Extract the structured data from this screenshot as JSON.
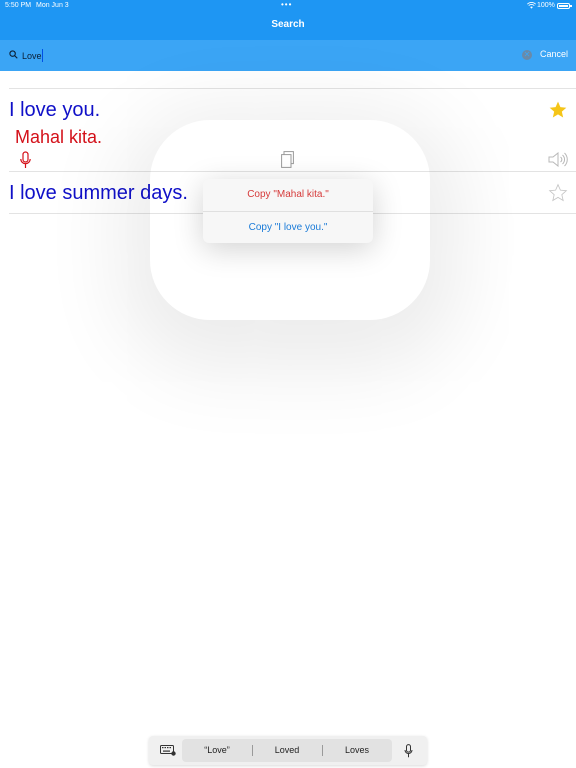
{
  "status_bar": {
    "time": "5:50 PM",
    "date": "Mon Jun 3",
    "battery": "100%"
  },
  "nav": {
    "title": "Search"
  },
  "search": {
    "value": "Love",
    "cancel_label": "Cancel"
  },
  "results": [
    {
      "english": "I love you.",
      "translation": "Mahal kita.",
      "favorite": true
    },
    {
      "english": "I love summer days.",
      "favorite": false
    }
  ],
  "copy_menu": {
    "items": [
      "Copy \"Mahal kita.\"",
      "Copy \"I love you.\""
    ]
  },
  "keyboard_suggestions": [
    "“Love”",
    "Loved",
    "Loves"
  ],
  "colors": {
    "header": "#1e96f3",
    "english_text": "#1010c8",
    "translation_text": "#d4111a",
    "star_filled": "#f5c518"
  },
  "icons": [
    "search-icon",
    "clear-icon",
    "star-filled-icon",
    "star-outline-icon",
    "microphone-icon",
    "copy-icon",
    "speaker-icon",
    "keyboard-icon"
  ]
}
